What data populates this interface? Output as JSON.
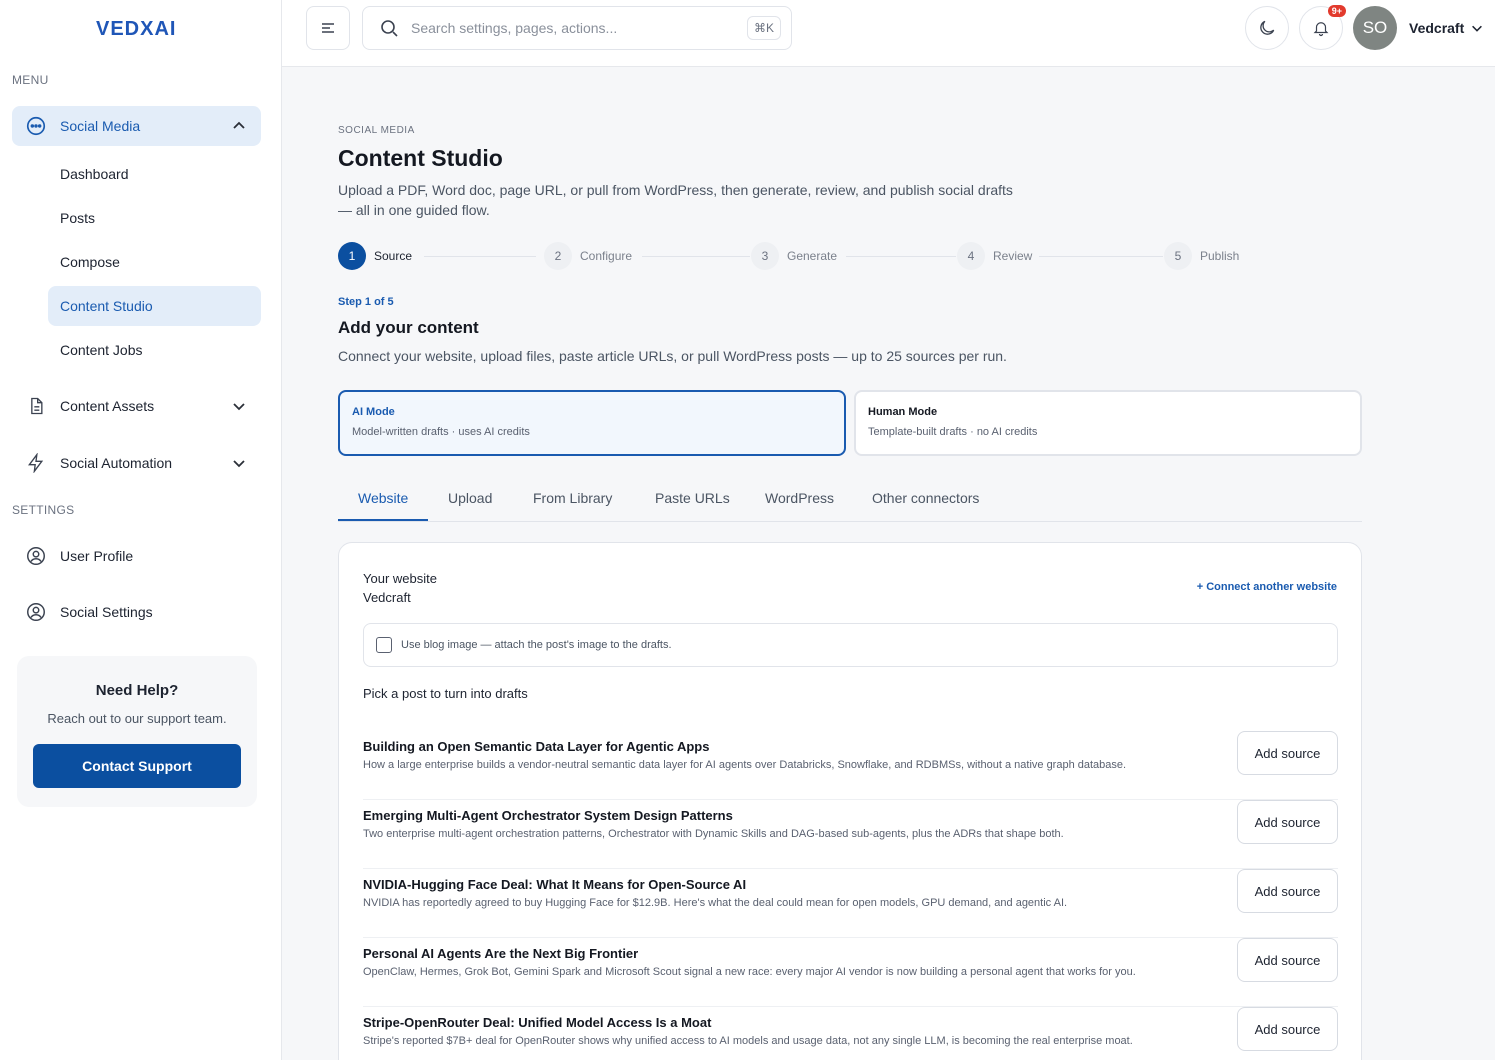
{
  "brand": {
    "logo": "VEDXAI"
  },
  "sidebar": {
    "menu_label": "MENU",
    "settings_label": "SETTINGS",
    "social_media": "Social Media",
    "sub_items": [
      "Dashboard",
      "Posts",
      "Compose",
      "Content Studio",
      "Content Jobs"
    ],
    "content_assets": "Content Assets",
    "social_automation": "Social Automation",
    "user_profile": "User Profile",
    "social_settings": "Social Settings",
    "help": {
      "title": "Need Help?",
      "text": "Reach out to our support team.",
      "button": "Contact Support"
    }
  },
  "header": {
    "search_placeholder": "Search settings, pages, actions...",
    "shortcut": "⌘K",
    "notification_count": "9+",
    "avatar_initials": "SO",
    "user_name": "Vedcraft"
  },
  "page": {
    "breadcrumb": "SOCIAL MEDIA",
    "title": "Content Studio",
    "description": "Upload a PDF, Word doc, page URL, or pull from WordPress, then generate, review, and publish social drafts — all in one guided flow.",
    "steps": [
      {
        "num": "1",
        "label": "Source"
      },
      {
        "num": "2",
        "label": "Configure"
      },
      {
        "num": "3",
        "label": "Generate"
      },
      {
        "num": "4",
        "label": "Review"
      },
      {
        "num": "5",
        "label": "Publish"
      }
    ],
    "step_count": "Step 1 of 5",
    "section_title": "Add your content",
    "section_sub": "Connect your website, upload files, paste article URLs, or pull WordPress posts — up to 25 sources per run.",
    "modes": [
      {
        "title": "AI Mode",
        "desc": "Model-written drafts · uses AI credits"
      },
      {
        "title": "Human Mode",
        "desc": "Template-built drafts · no AI credits"
      }
    ],
    "tabs": [
      "Website",
      "Upload",
      "From Library",
      "Paste URLs",
      "WordPress",
      "Other connectors"
    ],
    "card": {
      "website_label": "Your website",
      "website_value": "Vedcraft",
      "connect_link": "+ Connect another website",
      "checkbox_label": "Use blog image — attach the post's image to the drafts.",
      "pick_label": "Pick a post to turn into drafts",
      "add_label": "Add source",
      "posts": [
        {
          "title": "Building an Open Semantic Data Layer for Agentic Apps",
          "desc": "How a large enterprise builds a vendor-neutral semantic data layer for AI agents over Databricks, Snowflake, and RDBMSs, without a native graph database."
        },
        {
          "title": "Emerging Multi-Agent Orchestrator System Design Patterns",
          "desc": "Two enterprise multi-agent orchestration patterns, Orchestrator with Dynamic Skills and DAG-based sub-agents, plus the ADRs that shape both."
        },
        {
          "title": "NVIDIA-Hugging Face Deal: What It Means for Open-Source AI",
          "desc": "NVIDIA has reportedly agreed to buy Hugging Face for $12.9B. Here's what the deal could mean for open models, GPU demand, and agentic AI."
        },
        {
          "title": "Personal AI Agents Are the Next Big Frontier",
          "desc": "OpenClaw, Hermes, Grok Bot, Gemini Spark and Microsoft Scout signal a new race: every major AI vendor is now building a personal agent that works for you."
        },
        {
          "title": "Stripe-OpenRouter Deal: Unified Model Access Is a Moat",
          "desc": "Stripe's reported $7B+ deal for OpenRouter shows why unified access to AI models and usage data, not any single LLM, is becoming the real enterprise moat."
        }
      ]
    }
  }
}
